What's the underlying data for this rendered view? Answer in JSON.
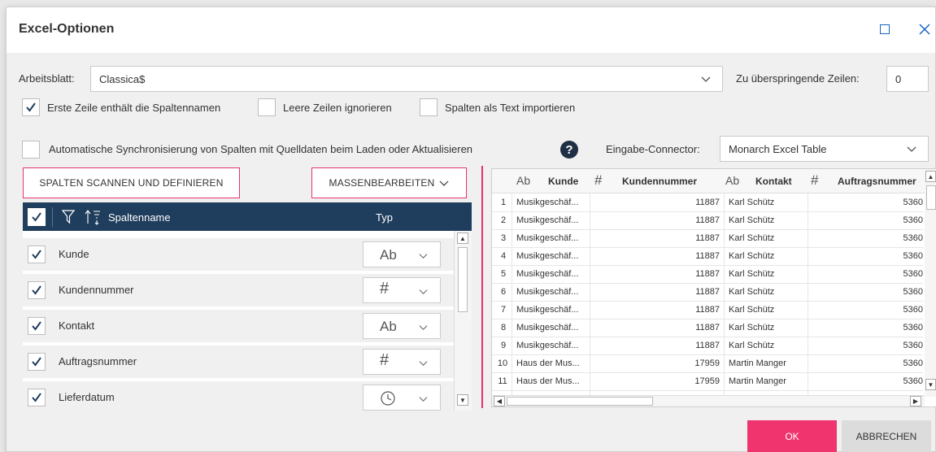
{
  "dialog": {
    "title": "Excel-Optionen"
  },
  "sheet": {
    "label": "Arbeitsblatt:",
    "value": "Classica$"
  },
  "skip_rows": {
    "label": "Zu überspringende Zeilen:",
    "value": "0"
  },
  "options": {
    "first_row": {
      "label": "Erste Zeile enthält die Spaltennamen",
      "checked": true
    },
    "ignore_empty": {
      "label": "Leere Zeilen ignorieren",
      "checked": false
    },
    "as_text": {
      "label": "Spalten als Text importieren",
      "checked": false
    },
    "auto_sync": {
      "label": "Automatische Synchronisierung von Spalten mit Quelldaten beim Laden oder Aktualisieren",
      "checked": false
    }
  },
  "help_glyph": "?",
  "connector": {
    "label": "Eingabe-Connector:",
    "value": "Monarch Excel Table"
  },
  "buttons": {
    "scan": "SPALTEN SCANNEN UND DEFINIEREN",
    "bulk_edit": "MASSENBEARBEITEN",
    "ok": "OK",
    "cancel": "ABBRECHEN"
  },
  "column_table": {
    "header_name": "Spaltenname",
    "header_type": "Typ",
    "rows": [
      {
        "name": "Kunde",
        "type_icon": "Ab",
        "checked": true
      },
      {
        "name": "Kundennummer",
        "type_icon": "#",
        "checked": true
      },
      {
        "name": "Kontakt",
        "type_icon": "Ab",
        "checked": true
      },
      {
        "name": "Auftragsnummer",
        "type_icon": "#",
        "checked": true
      },
      {
        "name": "Lieferdatum",
        "type_icon": "clock-icon",
        "checked": true
      }
    ]
  },
  "preview": {
    "headers": [
      {
        "icon": "Ab",
        "name": "Kunde"
      },
      {
        "icon": "#",
        "name": "Kundennummer"
      },
      {
        "icon": "Ab",
        "name": "Kontakt"
      },
      {
        "icon": "#",
        "name": "Auftragsnummer"
      }
    ],
    "rows": [
      [
        "1",
        "Musikgeschäf...",
        "11887",
        "Karl Schütz",
        "5360"
      ],
      [
        "2",
        "Musikgeschäf...",
        "11887",
        "Karl Schütz",
        "5360"
      ],
      [
        "3",
        "Musikgeschäf...",
        "11887",
        "Karl Schütz",
        "5360"
      ],
      [
        "4",
        "Musikgeschäf...",
        "11887",
        "Karl Schütz",
        "5360"
      ],
      [
        "5",
        "Musikgeschäf...",
        "11887",
        "Karl Schütz",
        "5360"
      ],
      [
        "6",
        "Musikgeschäf...",
        "11887",
        "Karl Schütz",
        "5360"
      ],
      [
        "7",
        "Musikgeschäf...",
        "11887",
        "Karl Schütz",
        "5360"
      ],
      [
        "8",
        "Musikgeschäf...",
        "11887",
        "Karl Schütz",
        "5360"
      ],
      [
        "9",
        "Musikgeschäf...",
        "11887",
        "Karl Schütz",
        "5360"
      ],
      [
        "10",
        "Haus der Mus...",
        "17959",
        "Martin Manger",
        "5360"
      ],
      [
        "11",
        "Haus der Mus...",
        "17959",
        "Martin Manger",
        "5360"
      ]
    ]
  },
  "colors": {
    "accent": "#f0346e",
    "header": "#1f3d5c",
    "check": "#1f3d5c"
  }
}
